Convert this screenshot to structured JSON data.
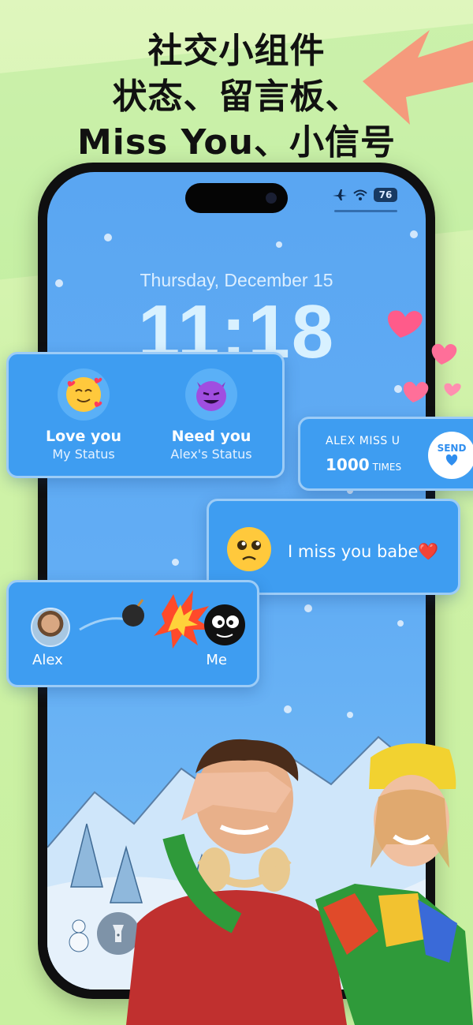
{
  "headline": {
    "line1": "社交小组件",
    "line2": "状态、留言板、",
    "line3": "Miss You、小信号"
  },
  "lockscreen": {
    "date": "Thursday, December 15",
    "time": "11:18",
    "battery": "76"
  },
  "status_widget": {
    "mine": {
      "title": "Love you",
      "subtitle": "My Status",
      "emoji": "smiling-face-with-hearts"
    },
    "partner": {
      "title": "Need you",
      "subtitle": "Alex's Status",
      "emoji": "smiling-face-with-horns"
    }
  },
  "miss_widget": {
    "label": "ALEX MISS U",
    "count": "1000",
    "unit": "TIMES",
    "send_label": "SEND"
  },
  "message_widget": {
    "text": "I miss you babe❤️",
    "emoji": "pleading-face"
  },
  "bomb_widget": {
    "left_name": "Alex",
    "right_name": "Me"
  },
  "colors": {
    "background": "#d6f4b4",
    "card": "#3e9df1",
    "screen": "#5aa6f2",
    "accent_arrow": "#f59a7c",
    "heart": "#ff5b8a"
  }
}
